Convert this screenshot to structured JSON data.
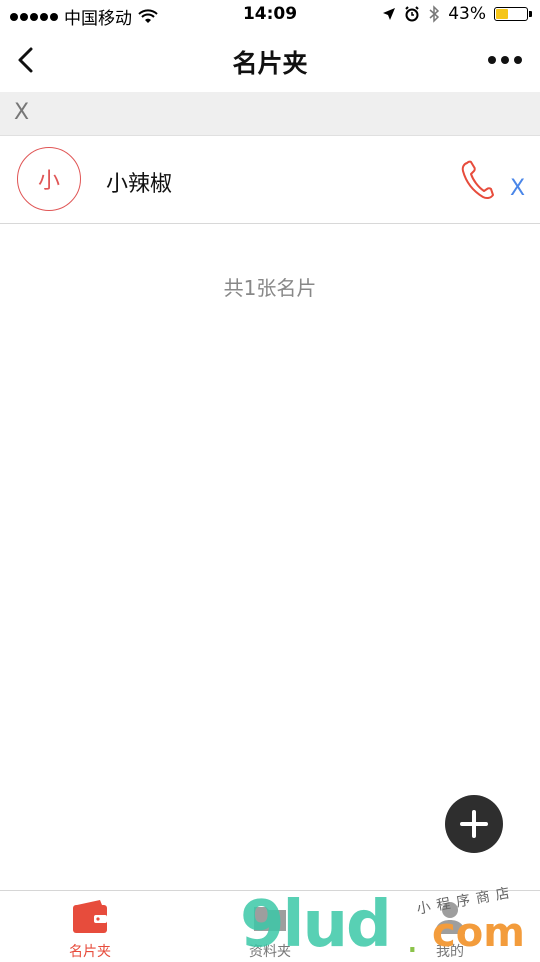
{
  "status_bar": {
    "carrier": "中国移动",
    "time": "14:09",
    "battery_percent": "43%",
    "battery_level": 0.43,
    "battery_color": "#f5c518"
  },
  "nav": {
    "title": "名片夹",
    "back_icon": "chevron-left-icon",
    "more_icon": "more-dots-icon"
  },
  "search_band": {
    "clear_label": "X"
  },
  "cards": [
    {
      "avatar_char": "小",
      "name": "小辣椒",
      "call_icon": "phone-icon",
      "delete_label": "X"
    }
  ],
  "count_text": "共1张名片",
  "fab": {
    "icon": "plus-icon"
  },
  "tabs": [
    {
      "label": "名片夹",
      "icon": "card-wallet-icon",
      "active": true
    },
    {
      "label": "资料夹",
      "icon": "folder-icon",
      "active": false
    },
    {
      "label": "我的",
      "icon": "user-icon",
      "active": false
    }
  ],
  "watermark": {
    "brand": "9lud",
    "dot": ".",
    "tld": "com",
    "tagline": "小程序商店"
  },
  "colors": {
    "accent": "#e74c3c",
    "link_blue": "#4a86e8",
    "fab": "#2e2e2e"
  }
}
